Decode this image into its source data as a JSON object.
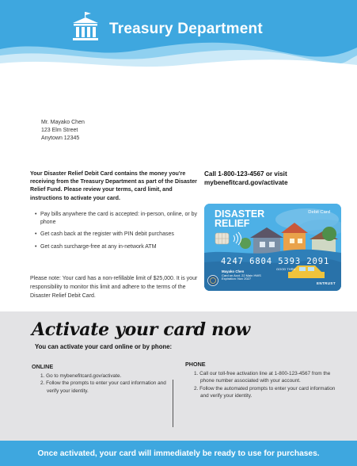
{
  "header": {
    "title": "Treasury Department",
    "icon": "government-building-icon"
  },
  "recipient": {
    "name": "Mr. Mayako Chen",
    "street": "123 Elm Street",
    "city_line": "Anytown 12345"
  },
  "intro": "Your Disaster Relief Debit Card contains the money you're receiving from the Treasury Department as part of the Disaster Relief Fund. Please review your terms, card limit, and instructions to activate your card.",
  "bullets": [
    "Pay bills anywhere the card is accepted: in-person, online, or by phone",
    "Get cash back at the register with PIN debit purchases",
    "Get cash surcharge-free at any in-network ATM"
  ],
  "note": "Please note: Your card has a non-refillable limit of $25,000. It is your responsibility to monitor this limit and adhere to the terms of the Disaster Relief Debit Card.",
  "cta": "Call 1-800-123-4567 or visit mybenefitcard.gov/activate",
  "card": {
    "title": "DISASTER RELIEF",
    "type": "Debit Card",
    "number": "4247 6804 5393 2091",
    "good_thru": "GOOD THRU",
    "holder": "Mayako Chen",
    "holder_line2": "Card on Acct. 22 Main HWS",
    "holder_line3": "Expiration: Nov 2027",
    "issuer": "ENTRUST",
    "colors": {
      "bg": "#4db0e6",
      "water": "#2f7fb8"
    }
  },
  "activate": {
    "title": "Activate your card now",
    "subtitle": "You can activate your card online or by phone:",
    "online": {
      "heading": "ONLINE",
      "steps": [
        "1. Go to mybenefitcard.gov/activate.",
        "2. Follow the prompts to enter your card information and verify your identity."
      ]
    },
    "phone": {
      "heading": "PHONE",
      "steps": [
        "1. Call our toll-free activation line at 1-800-123-4567 from the phone number associated with your account.",
        "2. Follow the automated prompts to enter your card information and verify your identity."
      ]
    }
  },
  "banner": "Once activated, your card will immediately be ready to use for purchases.",
  "colors": {
    "brand_blue": "#3ea7df",
    "panel_gray": "#e3e3e5"
  }
}
